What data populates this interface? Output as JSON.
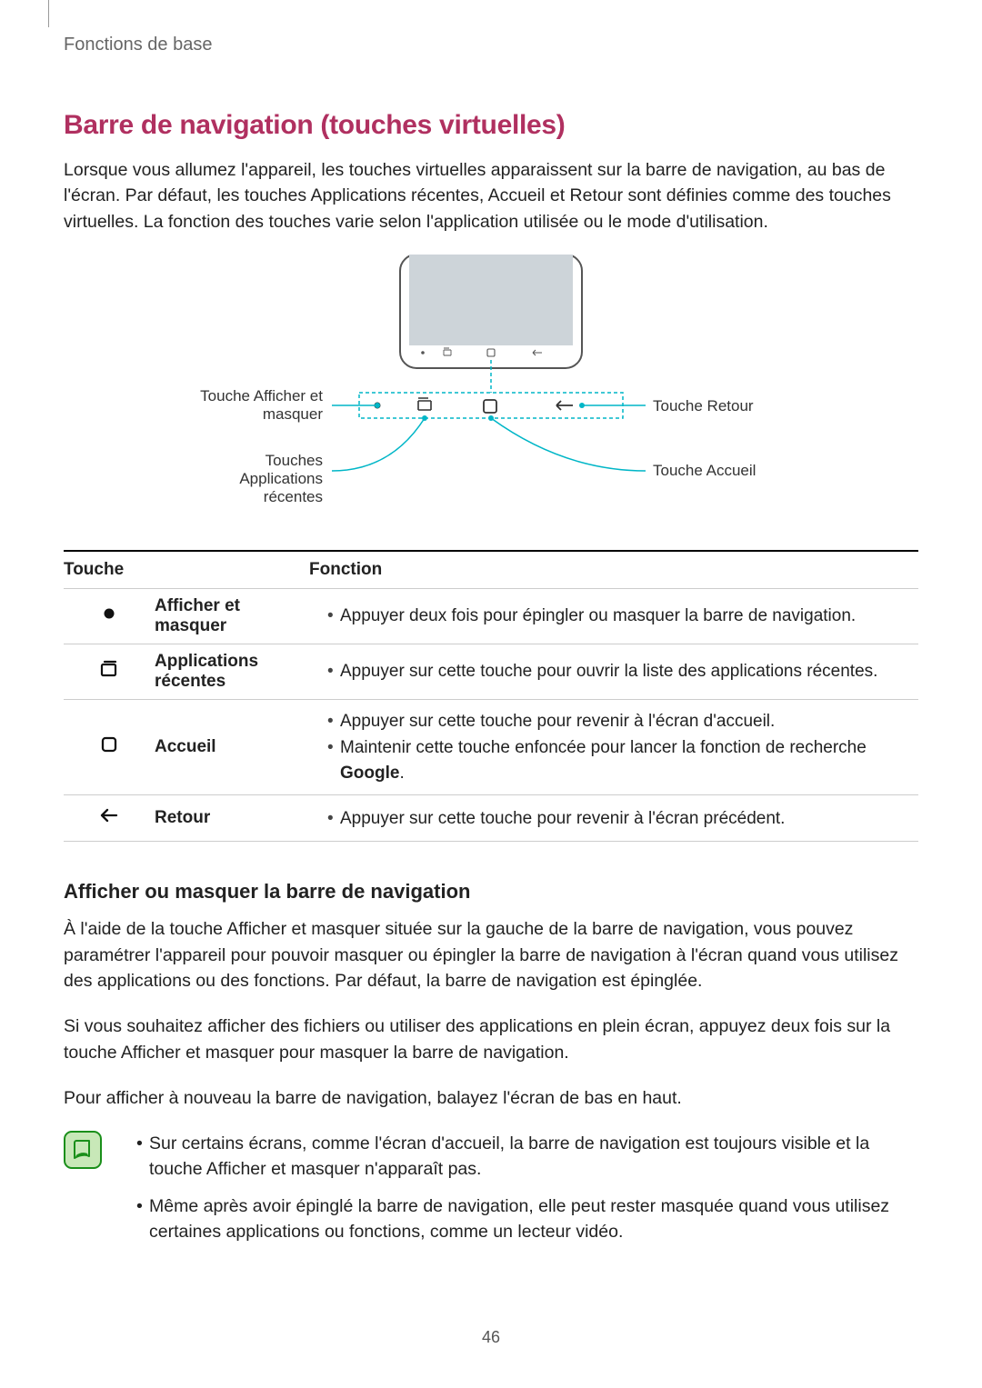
{
  "header": "Fonctions de base",
  "title": "Barre de navigation (touches virtuelles)",
  "intro": "Lorsque vous allumez l'appareil, les touches virtuelles apparaissent sur la barre de navigation, au bas de l'écran. Par défaut, les touches Applications récentes, Accueil et Retour sont définies comme des touches virtuelles. La fonction des touches varie selon l'application utilisée ou le mode d'utilisation.",
  "diagram": {
    "label_show_hide": "Touche Afficher et masquer",
    "label_recent": "Touches Applications récentes",
    "label_back": "Touche Retour",
    "label_home": "Touche Accueil"
  },
  "table": {
    "head_touch": "Touche",
    "head_func": "Fonction",
    "rows": [
      {
        "icon": "dot",
        "name": "Afficher et masquer",
        "funcs": [
          "Appuyer deux fois pour épingler ou masquer la barre de navigation."
        ]
      },
      {
        "icon": "recent",
        "name": "Applications récentes",
        "funcs": [
          "Appuyer sur cette touche pour ouvrir la liste des applications récentes."
        ]
      },
      {
        "icon": "home",
        "name": "Accueil",
        "funcs": [
          "Appuyer sur cette touche pour revenir à l'écran d'accueil.",
          "Maintenir cette touche enfoncée pour lancer la fonction de recherche Google."
        ]
      },
      {
        "icon": "back",
        "name": "Retour",
        "funcs": [
          "Appuyer sur cette touche pour revenir à l'écran précédent."
        ]
      }
    ]
  },
  "subheading": "Afficher ou masquer la barre de navigation",
  "para1": "À l'aide de la touche Afficher et masquer située sur la gauche de la barre de navigation, vous pouvez paramétrer l'appareil pour pouvoir masquer ou épingler la barre de navigation à l'écran quand vous utilisez des applications ou des fonctions. Par défaut, la barre de navigation est épinglée.",
  "para2": "Si vous souhaitez afficher des fichiers ou utiliser des applications en plein écran, appuyez deux fois sur la touche Afficher et masquer pour masquer la barre de navigation.",
  "para3": "Pour afficher à nouveau la barre de navigation, balayez l'écran de bas en haut.",
  "notes": [
    "Sur certains écrans, comme l'écran d'accueil, la barre de navigation est toujours visible et la touche Afficher et masquer n'apparaît pas.",
    "Même après avoir épinglé la barre de navigation, elle peut rester masquée quand vous utilisez certaines applications ou fonctions, comme un lecteur vidéo."
  ],
  "page_number": "46"
}
